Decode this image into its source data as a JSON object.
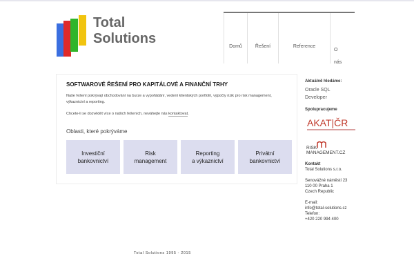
{
  "brand": {
    "name_line1": "Total",
    "name_line2": "Solutions",
    "colors": {
      "blue": "#3b6fe0",
      "red": "#e02a2a",
      "green": "#2fb52a",
      "yellow": "#f1c40f"
    }
  },
  "nav": {
    "items": [
      {
        "label": "Domů"
      },
      {
        "label": "Řešení"
      },
      {
        "label": "Reference"
      },
      {
        "label_line1": "O",
        "label_line2": "nás"
      }
    ]
  },
  "main": {
    "title": "SOFTWAROVÉ ŘEŠENÍ PRO KAPITÁLOVÉ A FINANČNÍ TRHY",
    "paragraph1": "Naše řešení pokrývají obchodování na burze a vypořádání, vedení klientských portfolií, výpočty rizik pro risk management, výkaznictví a reporting.",
    "paragraph2_prefix": "Chcete-li se dozvědět více o našich řešeních, neváhejte nás ",
    "paragraph2_link": "kontaktovat",
    "paragraph2_suffix": ".",
    "areas_title": "Oblasti, které pokrýváme",
    "cards": [
      {
        "line1": "Investiční",
        "line2": "bankovnictví"
      },
      {
        "line1": "Risk",
        "line2": "management"
      },
      {
        "line1": "Reporting",
        "line2": "a výkaznictví"
      },
      {
        "line1": "Privátní",
        "line2": "bankovnictví"
      }
    ]
  },
  "sidebar": {
    "hiring_title": "Aktuálně hledáme:",
    "hiring_line1": "Oracle SQL",
    "hiring_line2": "Developer",
    "partners_title": "Spolupracujeme",
    "partner1_text": "AKAT|ČR",
    "partner2_text": "RISK-MANAGEMENT.CZ",
    "contact_title": "Kontakt",
    "company": "Total Solutions s.r.o.",
    "address1": "Senovážné náměstí 23",
    "address2": "110 00 Praha 1",
    "address3": "Czech Republic",
    "email_label": "E-mail:",
    "email": "info@total-solutions.cz",
    "phone_label": "Telefon:",
    "phone": "+420 220 994 400"
  },
  "footer": {
    "text": "Total Solutions 1995 - 2015"
  }
}
